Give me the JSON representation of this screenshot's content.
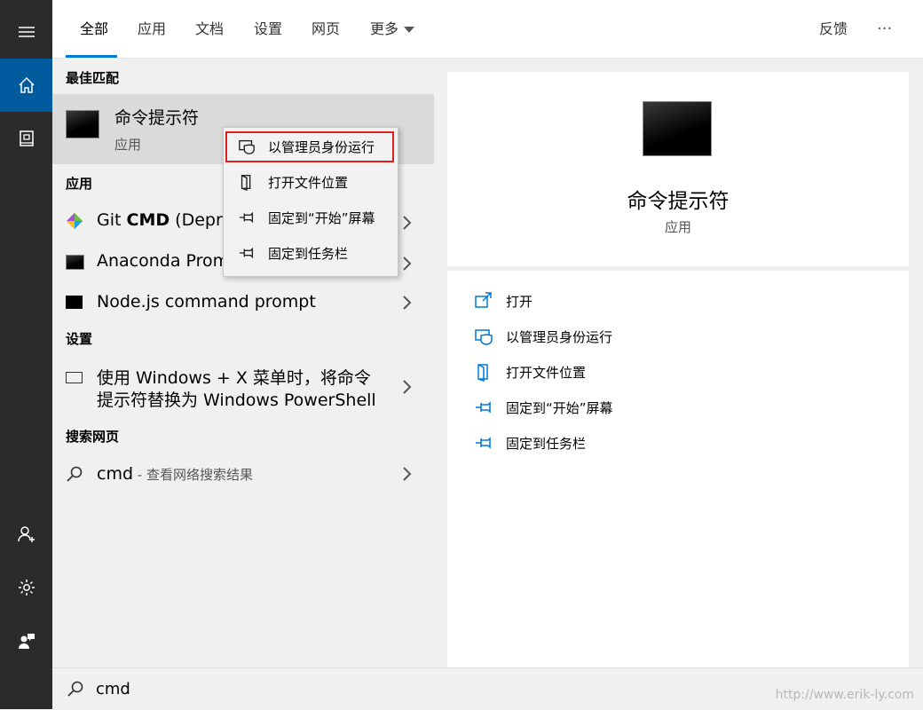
{
  "tabs": [
    {
      "label": "全部"
    },
    {
      "label": "应用"
    },
    {
      "label": "文档"
    },
    {
      "label": "设置"
    },
    {
      "label": "网页"
    },
    {
      "label": "更多"
    }
  ],
  "feedback_label": "反馈",
  "more_options_label": "···",
  "sections": {
    "best_match": "最佳匹配",
    "apps": "应用",
    "settings": "设置",
    "search_web": "搜索网页"
  },
  "best_match": {
    "title": "命令提示符",
    "subtitle": "应用"
  },
  "apps": [
    {
      "label_prefix": "Git ",
      "label_bold": "CMD",
      "label_suffix": " (Depre"
    },
    {
      "label": "Anaconda Prom"
    },
    {
      "label": "Node.js command prompt"
    }
  ],
  "settings_item": {
    "line1": "使用 Windows + X 菜单时，将命令",
    "line2": "提示符替换为 Windows PowerShell"
  },
  "web_item": {
    "query": "cmd",
    "suffix": " - 查看网络搜索结果"
  },
  "context_menu": [
    {
      "label": "以管理员身份运行",
      "icon": "shield-icon"
    },
    {
      "label": "打开文件位置",
      "icon": "folder-icon"
    },
    {
      "label": "固定到“开始”屏幕",
      "icon": "pin-icon"
    },
    {
      "label": "固定到任务栏",
      "icon": "pin-icon"
    }
  ],
  "detail": {
    "title": "命令提示符",
    "subtitle": "应用"
  },
  "actions": [
    {
      "label": "打开",
      "icon": "open-icon"
    },
    {
      "label": "以管理员身份运行",
      "icon": "shield-icon"
    },
    {
      "label": "打开文件位置",
      "icon": "folder-icon"
    },
    {
      "label": "固定到“开始”屏幕",
      "icon": "pin-icon"
    },
    {
      "label": "固定到任务栏",
      "icon": "pin-icon"
    }
  ],
  "search": {
    "value": "cmd"
  },
  "watermark": "http://www.erik-ly.com",
  "colors": {
    "accent": "#0078d7",
    "sidebar": "#2b2b2b",
    "active_nav": "#005a9e",
    "highlight_border": "#e02020"
  }
}
